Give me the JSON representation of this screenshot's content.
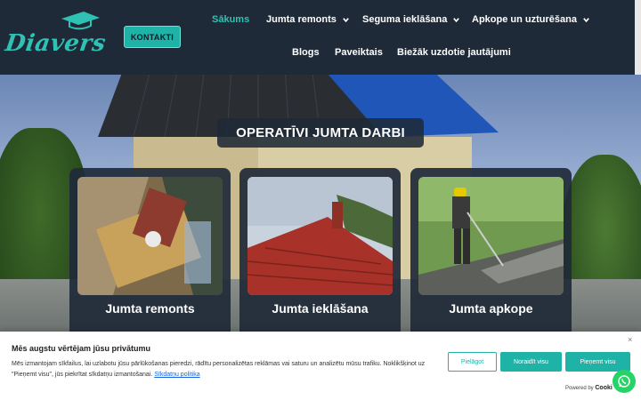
{
  "header": {
    "logo_text": "Diavers",
    "contact_label": "KONTAKTI",
    "nav": [
      {
        "label": "Sākums",
        "active": true,
        "has_dropdown": false
      },
      {
        "label": "Jumta remonts",
        "active": false,
        "has_dropdown": true
      },
      {
        "label": "Seguma ieklāšana",
        "active": false,
        "has_dropdown": true
      },
      {
        "label": "Apkope un uzturēšana",
        "active": false,
        "has_dropdown": true
      },
      {
        "label": "Blogs",
        "active": false,
        "has_dropdown": false
      },
      {
        "label": "Paveiktais",
        "active": false,
        "has_dropdown": false
      },
      {
        "label": "Biežāk uzdotie jautājumi",
        "active": false,
        "has_dropdown": false
      }
    ]
  },
  "hero": {
    "title": "OPERATĪVI JUMTA DARBI",
    "cards": [
      {
        "title": "Jumta remonts",
        "image": "roof-repair-photo"
      },
      {
        "title": "Jumta ieklāšana",
        "image": "red-tile-roof-photo"
      },
      {
        "title": "Jumta apkope",
        "image": "roof-pressure-washing-photo"
      }
    ]
  },
  "cookie": {
    "title": "Mēs augstu vērtējam jūsu privātumu",
    "text": "Mēs izmantojam sīkfailus, lai uzlabotu jūsu pārlūkošanas pieredzi, rādītu personalizētas reklāmas vai saturu un analizētu mūsu trafiku. Noklikšķinot uz \"Pieņemt visu\", jūs piekrītat sīkdatņu izmantošanai.",
    "link": "Sīkdatņu politika",
    "customize_label": "Pielāgot",
    "reject_label": "Noraidīt visu",
    "accept_label": "Pieņemt visu",
    "powered_by": "Powered by",
    "powered_brand": "Cooki",
    "close": "×"
  },
  "colors": {
    "accent": "#1fb2a6",
    "header_bg": "#1f2a38"
  },
  "icons": [
    "chevron-down-icon",
    "whatsapp-icon",
    "close-icon",
    "graduation-cap-icon"
  ]
}
